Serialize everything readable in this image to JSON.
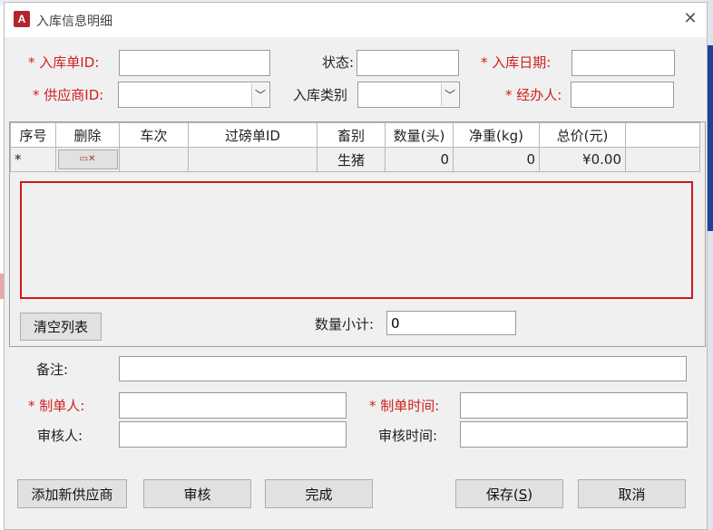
{
  "window": {
    "title": "入库信息明细",
    "app_icon_letter": "A",
    "close_glyph": "✕"
  },
  "header": {
    "receipt_id_label": "* 入库单ID:",
    "status_label": "状态:",
    "receipt_date_label": "* 入库日期:",
    "supplier_label": "* 供应商ID:",
    "category_label": "入库类别",
    "handler_label": "* 经办人:",
    "receipt_id_value": "",
    "status_value": "",
    "receipt_date_value": "",
    "supplier_value": "",
    "category_value": "",
    "handler_value": ""
  },
  "grid": {
    "columns": [
      "序号",
      "删除",
      "车次",
      "过磅单ID",
      "畜别",
      "数量(头)",
      "净重(kg)",
      "总价(元)"
    ],
    "new_row": {
      "marker": "*",
      "livestock": "生猪",
      "quantity": "0",
      "net_weight": "0",
      "total_price": "¥0.00"
    },
    "clear_button": "清空列表",
    "subtotal_label": "数量小计:",
    "subtotal_value": "0"
  },
  "remarks": {
    "label": "备注:",
    "value": ""
  },
  "audit": {
    "creator_label": "* 制单人:",
    "create_time_label": "* 制单时间:",
    "reviewer_label": "审核人:",
    "review_time_label": "审核时间:",
    "creator_value": "",
    "create_time_value": "",
    "reviewer_value": "",
    "review_time_value": ""
  },
  "footer": {
    "add_supplier": "添加新供应商",
    "review": "审核",
    "complete": "完成",
    "save_prefix": "保存(",
    "save_hotkey": "S",
    "save_suffix": ")",
    "cancel": "取消"
  },
  "colors": {
    "required": "#d21f1f",
    "highlight_border": "#d01818",
    "app_icon": "#b2262b"
  },
  "icons": {
    "delete_row": "delete-record-icon",
    "dropdown": "chevron-down-icon",
    "close": "close-icon"
  }
}
